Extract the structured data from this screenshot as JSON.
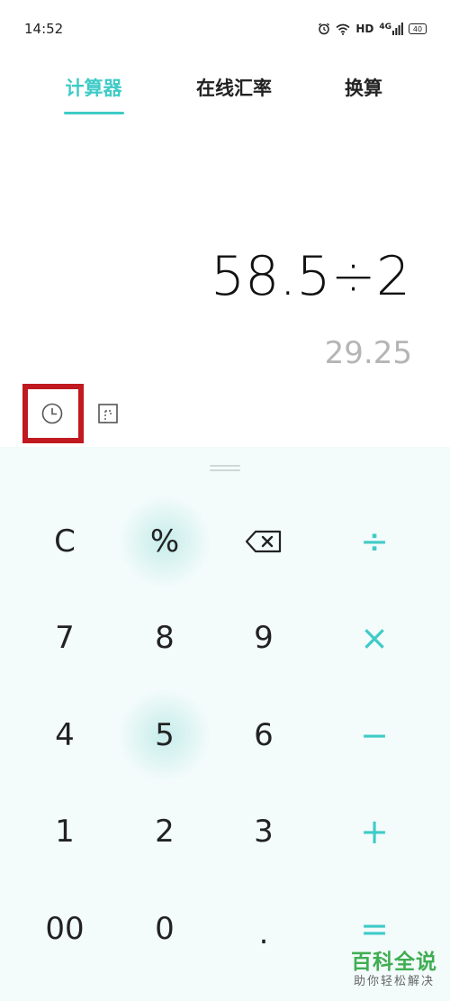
{
  "status_bar": {
    "time": "14:52",
    "hd_label": "HD",
    "network_label": "4G",
    "battery_level": "40",
    "icons": [
      "alarm-icon",
      "wifi-icon",
      "signal-icon",
      "battery-icon"
    ]
  },
  "tabs": [
    {
      "label": "计算器",
      "active": true
    },
    {
      "label": "在线汇率",
      "active": false
    },
    {
      "label": "换算",
      "active": false
    }
  ],
  "display": {
    "expression": "58.5÷2",
    "result": "29.25"
  },
  "tools": {
    "history_icon": "clock-icon",
    "mode_icon": "scientific-mode-icon"
  },
  "keypad": {
    "rows": [
      [
        "C",
        "%",
        "backspace",
        "÷"
      ],
      [
        "7",
        "8",
        "9",
        "×"
      ],
      [
        "4",
        "5",
        "6",
        "−"
      ],
      [
        "1",
        "2",
        "3",
        "+"
      ],
      [
        "00",
        "0",
        ".",
        "="
      ]
    ]
  },
  "watermark": {
    "title": "百科全说",
    "subtitle": "助你轻松解决"
  },
  "colors": {
    "accent": "#3fcbc7",
    "keypad_bg": "#f3fbfb",
    "highlight": "#c0191f",
    "result_text": "#b5b5b5"
  }
}
